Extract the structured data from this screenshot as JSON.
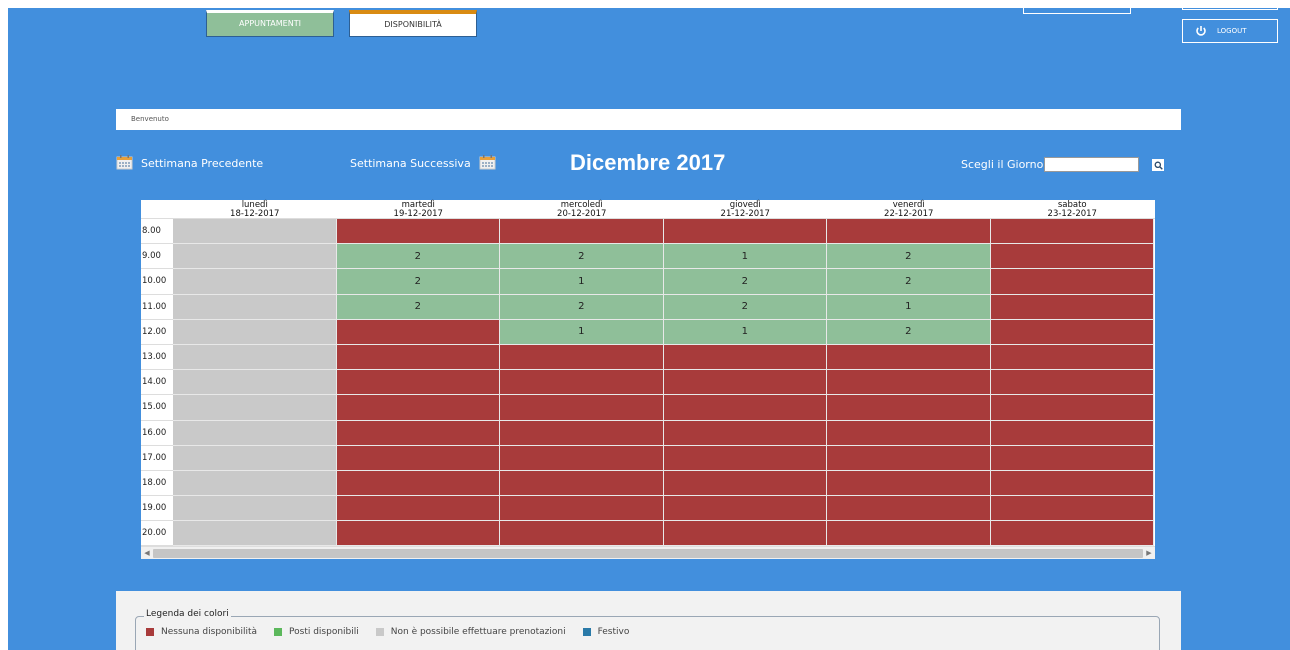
{
  "nav": {
    "tab_appuntamenti": "APPUNTAMENTI",
    "tab_disponibilita": "DISPONIBILITÀ",
    "logout": "LOGOUT"
  },
  "welcome": "Benvenuto",
  "week_nav": {
    "prev": "Settimana Precedente",
    "next": "Settimana Successiva"
  },
  "month_title": "Dicembre 2017",
  "day_picker": {
    "label": "Scegli il Giorno:",
    "value": ""
  },
  "calendar": {
    "days": [
      {
        "name": "lunedì",
        "date": "18-12-2017"
      },
      {
        "name": "martedì",
        "date": "19-12-2017"
      },
      {
        "name": "mercoledì",
        "date": "20-12-2017"
      },
      {
        "name": "giovedì",
        "date": "21-12-2017"
      },
      {
        "name": "venerdì",
        "date": "22-12-2017"
      },
      {
        "name": "sabato",
        "date": "23-12-2017"
      }
    ],
    "rows": [
      {
        "time": "8.00",
        "cells": [
          {
            "s": "closed",
            "v": ""
          },
          {
            "s": "none",
            "v": ""
          },
          {
            "s": "none",
            "v": ""
          },
          {
            "s": "none",
            "v": ""
          },
          {
            "s": "none",
            "v": ""
          },
          {
            "s": "none",
            "v": ""
          }
        ]
      },
      {
        "time": "9.00",
        "cells": [
          {
            "s": "closed",
            "v": ""
          },
          {
            "s": "avail",
            "v": "2"
          },
          {
            "s": "avail",
            "v": "2"
          },
          {
            "s": "avail",
            "v": "1"
          },
          {
            "s": "avail",
            "v": "2"
          },
          {
            "s": "none",
            "v": ""
          }
        ]
      },
      {
        "time": "10.00",
        "cells": [
          {
            "s": "closed",
            "v": ""
          },
          {
            "s": "avail",
            "v": "2"
          },
          {
            "s": "avail",
            "v": "1"
          },
          {
            "s": "avail",
            "v": "2"
          },
          {
            "s": "avail",
            "v": "2"
          },
          {
            "s": "none",
            "v": ""
          }
        ]
      },
      {
        "time": "11.00",
        "cells": [
          {
            "s": "closed",
            "v": ""
          },
          {
            "s": "avail",
            "v": "2"
          },
          {
            "s": "avail",
            "v": "2"
          },
          {
            "s": "avail",
            "v": "2"
          },
          {
            "s": "avail",
            "v": "1"
          },
          {
            "s": "none",
            "v": ""
          }
        ]
      },
      {
        "time": "12.00",
        "cells": [
          {
            "s": "closed",
            "v": ""
          },
          {
            "s": "none",
            "v": ""
          },
          {
            "s": "avail",
            "v": "1"
          },
          {
            "s": "avail",
            "v": "1"
          },
          {
            "s": "avail",
            "v": "2"
          },
          {
            "s": "none",
            "v": ""
          }
        ]
      },
      {
        "time": "13.00",
        "cells": [
          {
            "s": "closed",
            "v": ""
          },
          {
            "s": "none",
            "v": ""
          },
          {
            "s": "none",
            "v": ""
          },
          {
            "s": "none",
            "v": ""
          },
          {
            "s": "none",
            "v": ""
          },
          {
            "s": "none",
            "v": ""
          }
        ]
      },
      {
        "time": "14.00",
        "cells": [
          {
            "s": "closed",
            "v": ""
          },
          {
            "s": "none",
            "v": ""
          },
          {
            "s": "none",
            "v": ""
          },
          {
            "s": "none",
            "v": ""
          },
          {
            "s": "none",
            "v": ""
          },
          {
            "s": "none",
            "v": ""
          }
        ]
      },
      {
        "time": "15.00",
        "cells": [
          {
            "s": "closed",
            "v": ""
          },
          {
            "s": "none",
            "v": ""
          },
          {
            "s": "none",
            "v": ""
          },
          {
            "s": "none",
            "v": ""
          },
          {
            "s": "none",
            "v": ""
          },
          {
            "s": "none",
            "v": ""
          }
        ]
      },
      {
        "time": "16.00",
        "cells": [
          {
            "s": "closed",
            "v": ""
          },
          {
            "s": "none",
            "v": ""
          },
          {
            "s": "none",
            "v": ""
          },
          {
            "s": "none",
            "v": ""
          },
          {
            "s": "none",
            "v": ""
          },
          {
            "s": "none",
            "v": ""
          }
        ]
      },
      {
        "time": "17.00",
        "cells": [
          {
            "s": "closed",
            "v": ""
          },
          {
            "s": "none",
            "v": ""
          },
          {
            "s": "none",
            "v": ""
          },
          {
            "s": "none",
            "v": ""
          },
          {
            "s": "none",
            "v": ""
          },
          {
            "s": "none",
            "v": ""
          }
        ]
      },
      {
        "time": "18.00",
        "cells": [
          {
            "s": "closed",
            "v": ""
          },
          {
            "s": "none",
            "v": ""
          },
          {
            "s": "none",
            "v": ""
          },
          {
            "s": "none",
            "v": ""
          },
          {
            "s": "none",
            "v": ""
          },
          {
            "s": "none",
            "v": ""
          }
        ]
      },
      {
        "time": "19.00",
        "cells": [
          {
            "s": "closed",
            "v": ""
          },
          {
            "s": "none",
            "v": ""
          },
          {
            "s": "none",
            "v": ""
          },
          {
            "s": "none",
            "v": ""
          },
          {
            "s": "none",
            "v": ""
          },
          {
            "s": "none",
            "v": ""
          }
        ]
      },
      {
        "time": "20.00",
        "cells": [
          {
            "s": "closed",
            "v": ""
          },
          {
            "s": "none",
            "v": ""
          },
          {
            "s": "none",
            "v": ""
          },
          {
            "s": "none",
            "v": ""
          },
          {
            "s": "none",
            "v": ""
          },
          {
            "s": "none",
            "v": ""
          }
        ]
      }
    ]
  },
  "legend": {
    "title": "Legenda dei colori",
    "items": [
      {
        "label": "Nessuna disponibilità",
        "color": "#a83b3b"
      },
      {
        "label": "Posti disponibili",
        "color": "#5cb85c"
      },
      {
        "label": "Non è possibile effettuare prenotazioni",
        "color": "#c9c9c9"
      },
      {
        "label": "Festivo",
        "color": "#2a7aa8"
      }
    ]
  },
  "colors": {
    "background": "#428fdd",
    "no_availability": "#a83b3b",
    "available_cell": "#8fbf99",
    "closed_cell": "#c9c9c9",
    "tab_accent": "#d98b12"
  },
  "icons": [
    "calendar-icon",
    "search-icon",
    "power-icon"
  ]
}
